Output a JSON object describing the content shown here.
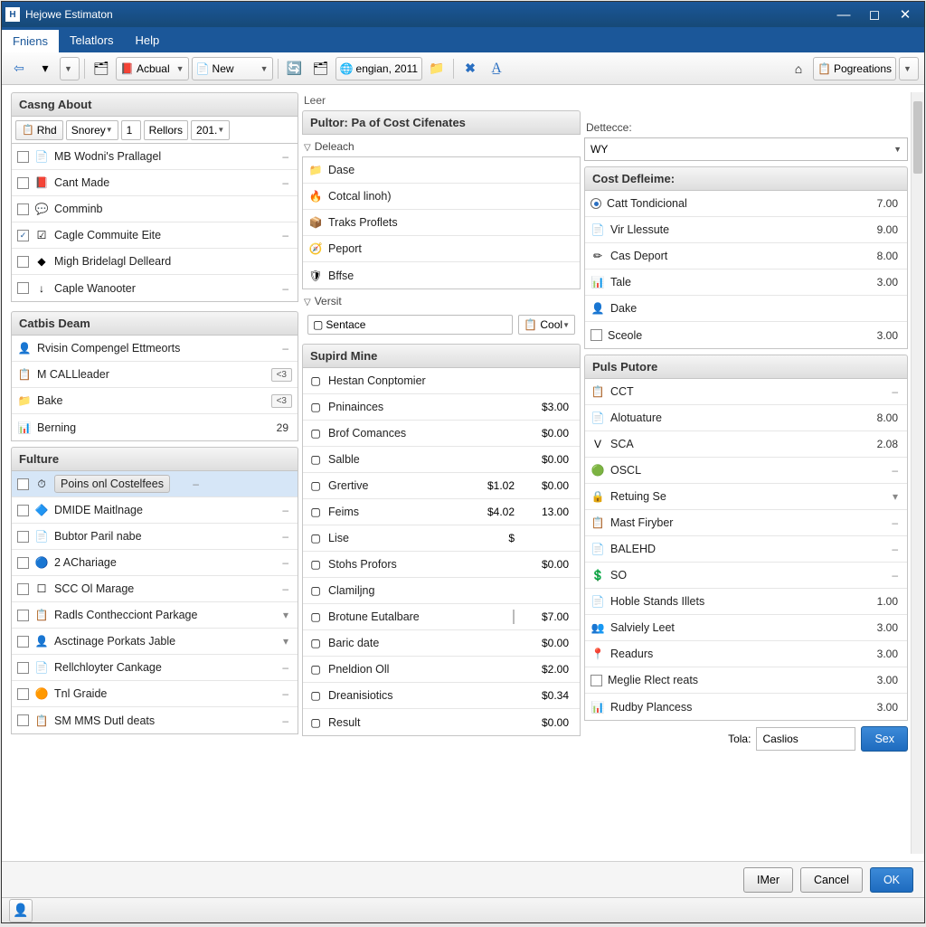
{
  "title": "Hejowe Estimaton",
  "menu": {
    "friens": "Fniens",
    "telators": "Telatlors",
    "help": "Help"
  },
  "toolbar": {
    "actual": "Acbual",
    "new": "New",
    "engine": "engian, 2011",
    "pogreations": "Pogreations"
  },
  "left": {
    "casng": {
      "header": "Casng About",
      "rhd": "Rhd",
      "snorey": "Snorey",
      "one": "1",
      "rellors": "Rellors",
      "year": "201.",
      "items": [
        {
          "icon": "📄",
          "label": "MB Wodni's Prallagel",
          "val": "–"
        },
        {
          "icon": "📕",
          "label": "Cant Made",
          "val": "–"
        },
        {
          "icon": "💬",
          "label": "Comminb",
          "val": ""
        },
        {
          "icon": "☑",
          "label": "Cagle Commuite Eite",
          "val": "–"
        },
        {
          "icon": "◆",
          "label": "Migh Bridelagl Delleard",
          "val": ""
        },
        {
          "icon": "↓",
          "label": "Caple Wanooter",
          "val": "–"
        }
      ]
    },
    "catbis": {
      "header": "Catbis Deam",
      "items": [
        {
          "icon": "👤",
          "label": "Rvisin Compengel Ettmeorts",
          "val": "–"
        },
        {
          "icon": "📋",
          "label": "M CALLleader",
          "badge": "<3"
        },
        {
          "icon": "📁",
          "label": "Bake",
          "badge": "<3"
        },
        {
          "icon": "📊",
          "label": "Berning",
          "val": "29"
        }
      ]
    },
    "fulture": {
      "header": "Fulture",
      "highlight": "Poins onl Costelfees",
      "items": [
        {
          "icon": "⏱",
          "label": "Poins onl Costelfees",
          "val": "–",
          "sel": true
        },
        {
          "icon": "🔷",
          "label": "DMIDE Maitlnage",
          "val": "–"
        },
        {
          "icon": "📄",
          "label": "Bubtor Paril nabe",
          "val": "–"
        },
        {
          "icon": "🔵",
          "label": "2 AChariage",
          "val": "–"
        },
        {
          "icon": "☐",
          "label": "SCC Ol Marage",
          "val": "–"
        },
        {
          "icon": "📋",
          "label": "Radls Conthecciont Parkage",
          "val": "▾"
        },
        {
          "icon": "👤",
          "label": "Asctinage Porkats Jable",
          "val": "▾"
        },
        {
          "icon": "📄",
          "label": "Rellchloyter Cankage",
          "val": "–"
        },
        {
          "icon": "🟠",
          "label": "Tnl Graide",
          "val": "–"
        },
        {
          "icon": "📋",
          "label": "SM MMS Dutl deats",
          "val": "–"
        }
      ]
    }
  },
  "mid": {
    "leer": "Leer",
    "header": "Pultor: Pa of Cost Cifenates",
    "deleach": "Deleach",
    "deleach_items": [
      {
        "icon": "📁",
        "label": "Dase"
      },
      {
        "icon": "🔥",
        "label": "Cotcal linoh)"
      },
      {
        "icon": "📦",
        "label": "Traks Proflets"
      },
      {
        "icon": "🧭",
        "label": "Peport"
      },
      {
        "icon": "🛡",
        "label": "Bffse"
      }
    ],
    "versit": "Versit",
    "sentace": "Sentace",
    "cool": "Cool",
    "supird": {
      "header": "Supird Mine",
      "items": [
        {
          "label": "Hestan Conptomier",
          "c2": "",
          "c3": ""
        },
        {
          "label": "Pninainces",
          "c2": "",
          "c3": "$3.00"
        },
        {
          "label": "Brof Comances",
          "c2": "",
          "c3": "$0.00"
        },
        {
          "label": "Salble",
          "c2": "",
          "c3": "$0.00"
        },
        {
          "label": "Grertive",
          "c2": "$1.02",
          "c3": "$0.00"
        },
        {
          "label": "Feims",
          "c2": "$4.02",
          "c3": "13.00"
        },
        {
          "label": "Lise",
          "c2": "$",
          "c3": ""
        },
        {
          "label": "Stohs Profors",
          "c2": "",
          "c3": "$0.00"
        },
        {
          "label": "Clamiljng",
          "c2": "",
          "c3": ""
        },
        {
          "label": "Brotune Eutalbare",
          "c2": "▫",
          "c3": "$7.00"
        },
        {
          "label": "Baric date",
          "c2": "",
          "c3": "$0.00"
        },
        {
          "label": "Pneldion Oll",
          "c2": "",
          "c3": "$2.00"
        },
        {
          "label": "Dreanisiotics",
          "c2": "",
          "c3": "$0.34"
        },
        {
          "label": "Result",
          "c2": "",
          "c3": "$0.00"
        }
      ]
    }
  },
  "right": {
    "dettecce": "Dettecce:",
    "wy": "WY",
    "cost": {
      "header": "Cost Defleime:",
      "items": [
        {
          "radio": true,
          "on": true,
          "label": "Catt Tondicional",
          "val": "7.00"
        },
        {
          "icon": "📄",
          "label": "Vir Llessute",
          "val": "9.00"
        },
        {
          "icon": "✏",
          "label": "Cas Deport",
          "val": "8.00"
        },
        {
          "icon": "📊",
          "label": "Tale",
          "val": "3.00"
        },
        {
          "icon": "👤",
          "label": "Dake",
          "val": ""
        },
        {
          "chk": true,
          "label": "Sceole",
          "val": "3.00"
        }
      ]
    },
    "puls": {
      "header": "Puls Putore",
      "items": [
        {
          "icon": "📋",
          "label": "CCT",
          "val": "–"
        },
        {
          "icon": "📄",
          "label": "Alotuature",
          "val": "8.00"
        },
        {
          "icon": "V",
          "label": "SCA",
          "val": "2.08"
        },
        {
          "icon": "🟢",
          "label": "OSCL",
          "val": "–"
        },
        {
          "icon": "🔒",
          "label": "Retuing Se",
          "val": "▾"
        },
        {
          "icon": "📋",
          "label": "Mast Firyber",
          "val": "–"
        },
        {
          "icon": "📄",
          "label": "BALEHD",
          "val": "–"
        },
        {
          "icon": "💲",
          "label": "SO",
          "val": "–"
        },
        {
          "icon": "📄",
          "label": "Hoble Stands Illets",
          "val": "1.00"
        },
        {
          "icon": "👥",
          "label": "Salviely Leet",
          "val": "3.00"
        },
        {
          "icon": "📍",
          "label": "Readurs",
          "val": "3.00"
        },
        {
          "chk": true,
          "label": "Meglie Rlect reats",
          "val": "3.00"
        },
        {
          "icon": "📊",
          "label": "Rudby Plancess",
          "val": "3.00"
        }
      ]
    },
    "tola": "Tola:",
    "casios": "Caslios",
    "sex": "Sex"
  },
  "footer": {
    "imer": "IMer",
    "cancel": "Cancel",
    "ok": "OK"
  }
}
